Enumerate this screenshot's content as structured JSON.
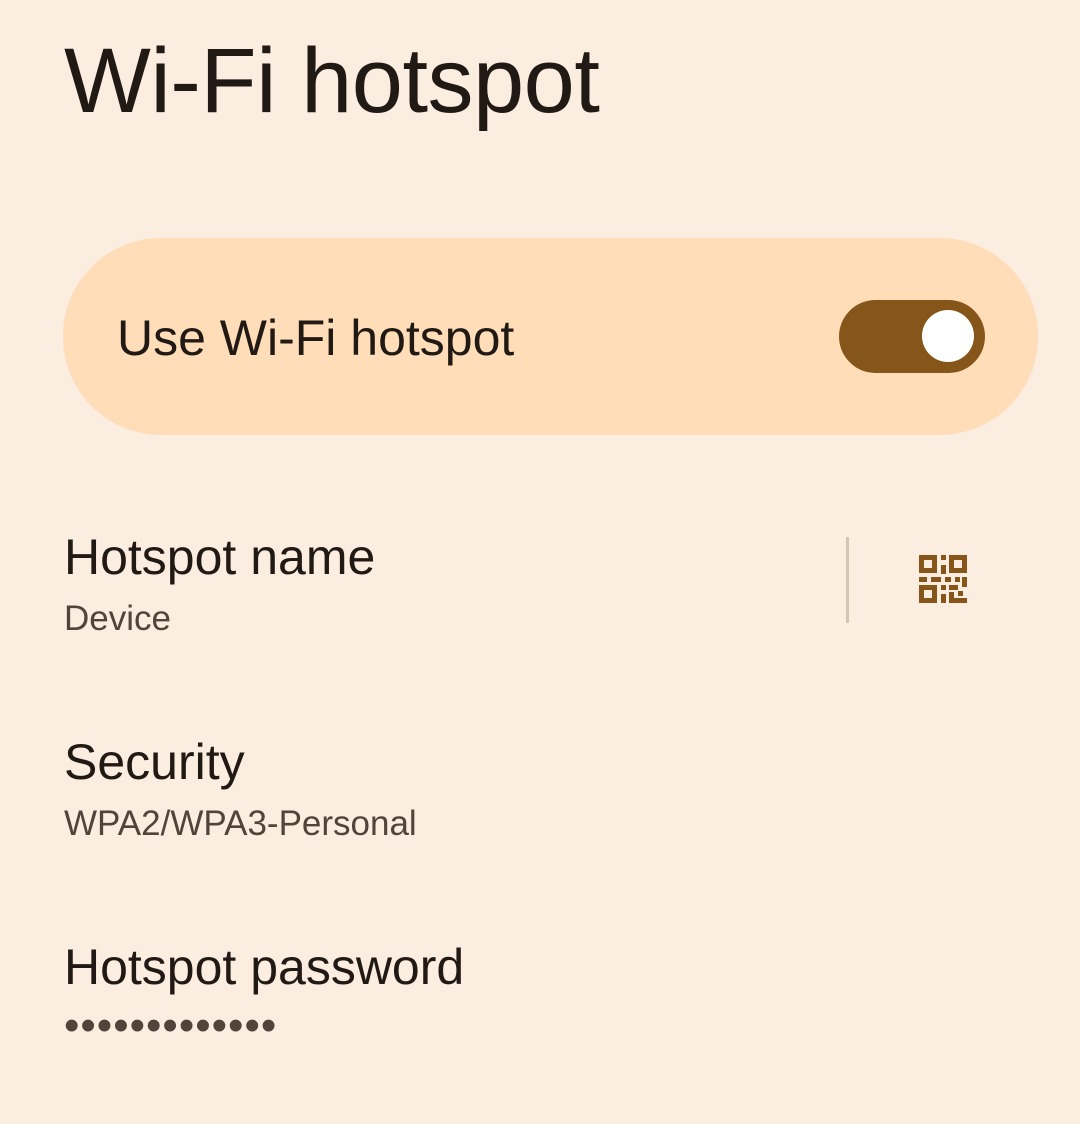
{
  "page": {
    "title": "Wi-Fi hotspot"
  },
  "main_switch": {
    "label": "Use Wi-Fi hotspot",
    "checked": true
  },
  "preferences": {
    "hotspot_name": {
      "title": "Hotspot name",
      "summary": "Device",
      "action_icon": "qr-code-icon"
    },
    "security": {
      "title": "Security",
      "summary": "WPA2/WPA3-Personal"
    },
    "password": {
      "title": "Hotspot password",
      "summary": "•••••••••••••"
    }
  },
  "colors": {
    "background": "#FBEDE0",
    "switch_container": "#FEDDB8",
    "accent": "#85551A",
    "primary_text": "#211A14",
    "secondary_text": "#52443A"
  }
}
